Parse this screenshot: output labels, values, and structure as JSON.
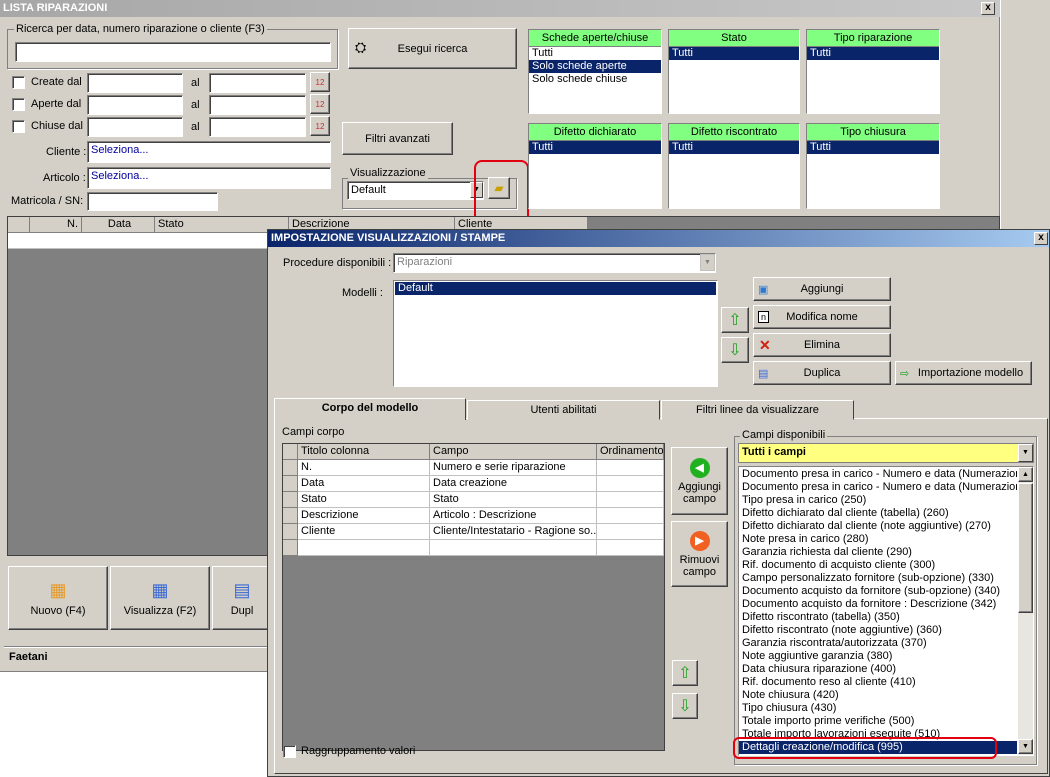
{
  "main": {
    "title": "LISTA RIPARAZIONI",
    "close": "x",
    "search_group": "Ricerca per data, numero riparazione o cliente (F3)",
    "search_value": "",
    "search_button": "Esegui ricerca",
    "create_label": "Create dal",
    "open_label": "Aperte dal",
    "closed_label": "Chiuse dal",
    "al": "al",
    "cliente_label": "Cliente :",
    "cliente_value": "Seleziona...",
    "articolo_label": "Articolo :",
    "articolo_value": "Seleziona...",
    "matricola_label": "Matricola / SN:",
    "filter_button": "Filtri avanzati",
    "view_group": "Visualizzazione",
    "view_value": "Default",
    "filters": [
      {
        "title": "Schede aperte/chiuse",
        "items": [
          "Tutti",
          "Solo schede aperte",
          "Solo schede chiuse"
        ],
        "selected": 1
      },
      {
        "title": "Stato",
        "items": [
          "Tutti"
        ],
        "selected": 0
      },
      {
        "title": "Tipo riparazione",
        "items": [
          "Tutti"
        ],
        "selected": 0
      },
      {
        "title": "Difetto dichiarato",
        "items": [
          "Tutti"
        ],
        "selected": 0
      },
      {
        "title": "Difetto riscontrato",
        "items": [
          "Tutti"
        ],
        "selected": 0
      },
      {
        "title": "Tipo chiusura",
        "items": [
          "Tutti"
        ],
        "selected": 0
      }
    ],
    "grid_headers": [
      "N.",
      "Data",
      "Stato",
      "Descrizione",
      "Cliente"
    ],
    "buttons": [
      "Nuovo (F4)",
      "Visualizza (F2)",
      "Dupl"
    ],
    "status": "Faetani"
  },
  "dialog": {
    "title": "IMPOSTAZIONE VISUALIZZAZIONI / STAMPE",
    "close": "x",
    "procedure_label": "Procedure disponibili :",
    "procedure_value": "Riparazioni",
    "models_label": "Modelli :",
    "models": [
      "Default"
    ],
    "add": "Aggiungi",
    "rename": "Modifica nome",
    "delete": "Elimina",
    "duplicate": "Duplica",
    "import": "Importazione modello",
    "tabs": [
      "Corpo del modello",
      "Utenti abilitati",
      "Filtri linee da visualizzare"
    ],
    "fields_group": "Campi corpo",
    "col_headers": [
      "Titolo colonna",
      "Campo",
      "Ordinamento"
    ],
    "rows": [
      {
        "title": "N.",
        "field": "Numero e serie riparazione",
        "order": ""
      },
      {
        "title": "Data",
        "field": "Data creazione",
        "order": ""
      },
      {
        "title": "Stato",
        "field": "Stato",
        "order": ""
      },
      {
        "title": "Descrizione",
        "field": "Articolo : Descrizione",
        "order": ""
      },
      {
        "title": "Cliente",
        "field": "Cliente/Intestatario - Ragione so...",
        "order": ""
      }
    ],
    "add_field": "Aggiungi campo",
    "remove_field": "Rimuovi campo",
    "group_values": "Raggruppamento valori",
    "available_group": "Campi disponibili",
    "available_filter": "Tutti i campi",
    "available": [
      "Documento presa in carico - Numero e data (Numerazione",
      "Documento presa in carico - Numero e data (Numerazione",
      "Tipo presa in carico (250)",
      "Difetto dichiarato dal cliente (tabella) (260)",
      "Difetto dichiarato dal cliente (note aggiuntive) (270)",
      "Note presa in carico (280)",
      "Garanzia richiesta dal cliente (290)",
      "Rif. documento di acquisto cliente (300)",
      "Campo personalizzato fornitore (sub-opzione) (330)",
      "Documento acquisto da fornitore (sub-opzione) (340)",
      "Documento acquisto da fornitore : Descrizione (342)",
      "Difetto riscontrato (tabella) (350)",
      "Difetto riscontrato (note aggiuntive) (360)",
      "Garanzia riscontrata/autorizzata (370)",
      "Note aggiuntive garanzia (380)",
      "Data chiusura riparazione (400)",
      "Rif. documento reso al cliente (410)",
      "Note chiusura (420)",
      "Tipo chiusura (430)",
      "Totale importo prime verifiche (500)",
      "Totale importo lavorazioni eseguite (510)",
      "Dettagli creazione/modifica (995)"
    ],
    "available_selected": 21
  },
  "colors": {
    "title_from": "#7a96df",
    "title_to": "#a6caf0",
    "header_green": "#80ff80",
    "selection": "#0a246a",
    "highlight": "#e00010",
    "yellow": "#ffff80"
  }
}
